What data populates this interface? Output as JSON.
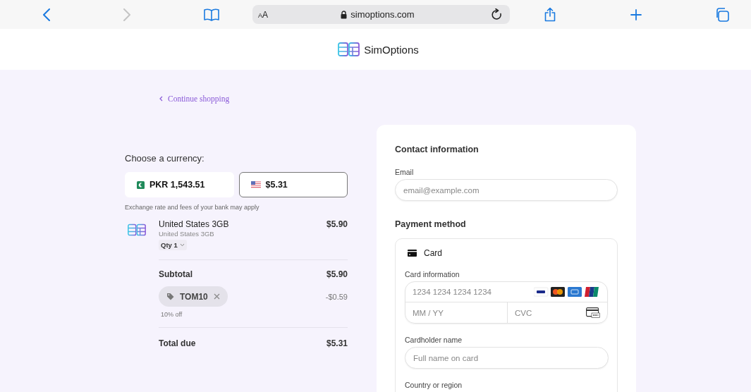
{
  "browser": {
    "back_enabled": true,
    "forward_enabled": false,
    "text_size_button": "AA",
    "url": "simoptions.com"
  },
  "header": {
    "brand": "SimOptions"
  },
  "continue_link": "Continue shopping",
  "currency": {
    "heading": "Choose a currency:",
    "options": [
      {
        "kind": "pk",
        "amount": "PKR 1,543.51",
        "selected": false
      },
      {
        "kind": "us",
        "amount": "$5.31",
        "selected": true
      }
    ],
    "note": "Exchange rate and fees of your bank may apply"
  },
  "item": {
    "name": "United States 3GB",
    "description": "United States 3GB",
    "quantity": "Qty 1",
    "price": "$5.90"
  },
  "subtotal": {
    "label": "Subtotal",
    "amount": "$5.90"
  },
  "promo": {
    "code": "TOM10",
    "discount": "-$0.59",
    "note": "10% off"
  },
  "total": {
    "label": "Total due",
    "amount": "$5.31"
  },
  "contact": {
    "heading": "Contact information",
    "email_label": "Email",
    "email_placeholder": "email@example.com"
  },
  "payment": {
    "heading": "Payment method",
    "method": "Card",
    "card_label": "Card information",
    "number_placeholder": "1234 1234 1234 1234",
    "expiry_placeholder": "MM / YY",
    "cvc_placeholder": "CVC",
    "name_label": "Cardholder name",
    "name_placeholder": "Full name on card",
    "country_label": "Country or region"
  }
}
